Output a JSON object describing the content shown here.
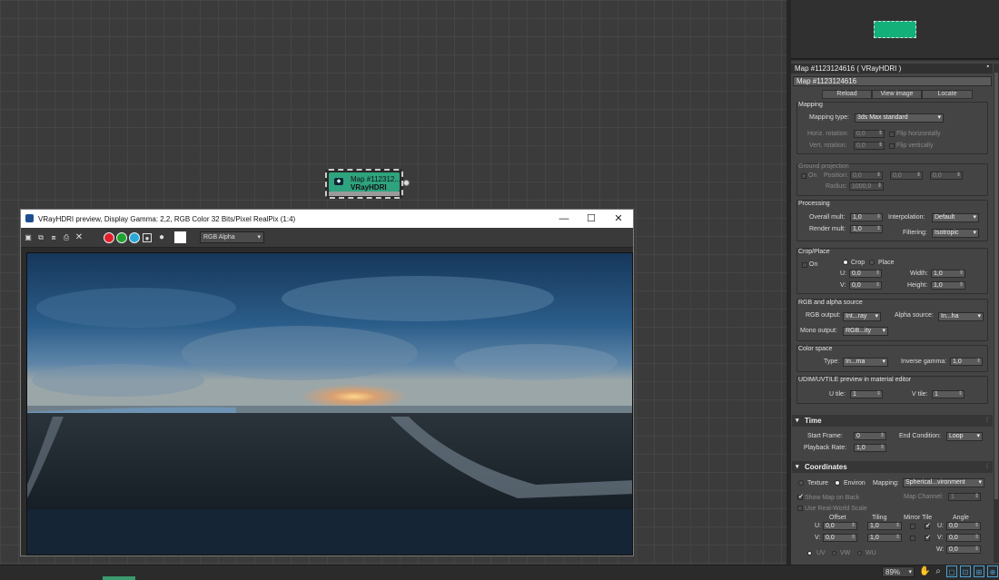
{
  "node": {
    "title": "Map #112312...",
    "subtitle": "VRayHDRI"
  },
  "preview_window": {
    "title": "VRayHDRI preview, Display Gamma: 2,2, RGB Color 32 Bits/Pixel RealPix (1:4)",
    "minimize": "—",
    "maximize": "☐",
    "close": "✕",
    "channel": "RGB Alpha",
    "channel_dots": [
      "#e0202c",
      "#1fa32f",
      "#29a8d9"
    ]
  },
  "panel": {
    "title": "Map #1123124616  ( VRayHDRI )",
    "name_field": "Map #1123124616",
    "buttons": {
      "reload": "Reload",
      "view_image": "View image",
      "locate": "Locate"
    },
    "mapping": {
      "title": "Mapping",
      "type_label": "Mapping type:",
      "type_value": "3ds Max standard",
      "horiz_label": "Horiz. rotation:",
      "horiz_value": "0,0",
      "flip_h": "Flip horizontally",
      "vert_label": "Vert. rotation:",
      "vert_value": "0,0",
      "flip_v": "Flip vertically"
    },
    "ground": {
      "title": "Ground projection",
      "on": "On",
      "position_label": "Position:",
      "pos": [
        "0,0",
        "0,0",
        "0,0"
      ],
      "radius_label": "Radius:",
      "radius_value": "1000,0"
    },
    "processing": {
      "title": "Processing",
      "overall_label": "Overall mult:",
      "overall_value": "1,0",
      "render_label": "Render mult:",
      "render_value": "1,0",
      "interp_label": "Interpolation:",
      "interp_value": "Default",
      "filter_label": "Filtering:",
      "filter_value": "Isotropic"
    },
    "crop": {
      "title": "Crop/Place",
      "on": "On",
      "crop": "Crop",
      "place": "Place",
      "u_label": "U:",
      "u_value": "0,0",
      "v_label": "V:",
      "v_value": "0,0",
      "w_label": "Width:",
      "w_value": "1,0",
      "h_label": "Height:",
      "h_value": "1,0"
    },
    "rgb_alpha": {
      "title": "RGB and alpha source",
      "rgb_label": "RGB output:",
      "rgb_value": "Int...ray",
      "alpha_label": "Alpha source:",
      "alpha_value": "In...ha",
      "mono_label": "Mono output:",
      "mono_value": "RGB...ity"
    },
    "color_space": {
      "title": "Color space",
      "type_label": "Type:",
      "type_value": "In...ma",
      "gamma_label": "Inverse gamma:",
      "gamma_value": "1,0"
    },
    "udim": {
      "title": "UDIM/UVTILE preview in material editor",
      "u_label": "U tile:",
      "u_value": "1",
      "v_label": "V tile:",
      "v_value": "1"
    },
    "time": {
      "title": "Time",
      "start_label": "Start Frame:",
      "start_value": "0",
      "rate_label": "Playback Rate:",
      "rate_value": "1,0",
      "end_label": "End Condition:",
      "end_value": "Loop"
    },
    "coordinates": {
      "title": "Coordinates",
      "texture": "Texture",
      "environ": "Environ",
      "mapping_label": "Mapping:",
      "mapping_value": "Spherical...vironment",
      "show_map": "Show Map on Back",
      "map_channel_label": "Map Channel:",
      "map_channel_value": "1",
      "real_world": "Use Real-World Scale",
      "offset": "Offset",
      "tiling": "Tiling",
      "mirror_tile": "Mirror Tile",
      "angle": "Angle",
      "u": "U:",
      "v": "V:",
      "w": "W:",
      "u_offset": "0,0",
      "v_offset": "0,0",
      "u_tiling": "1,0",
      "v_tiling": "1,0",
      "u_angle": "0,0",
      "v_angle": "0,0",
      "w_angle": "0,0",
      "uv": "UV",
      "vw": "VW",
      "wu": "WU"
    }
  },
  "statusbar": {
    "zoom": "89%"
  }
}
